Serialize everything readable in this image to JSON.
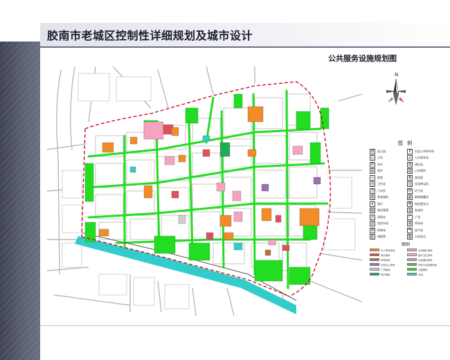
{
  "title": "胶南市老城区控制性详细规划及城市设计",
  "subtitle": "公共服务设施规划图",
  "north_label": "N",
  "legend": {
    "title": "图 例",
    "items": [
      {
        "icon": "kindergarten-icon",
        "label": "幼儿园"
      },
      {
        "icon": "parking-icon",
        "label": "社会公共停车场"
      },
      {
        "icon": "primary-school-icon",
        "label": "小学"
      },
      {
        "icon": "bus-station-icon",
        "label": "公交首末站"
      },
      {
        "icon": "middle-school-icon",
        "label": "初中"
      },
      {
        "icon": "substation-icon",
        "label": "调压站"
      },
      {
        "icon": "high-school-icon",
        "label": "高中"
      },
      {
        "icon": "toilet-icon",
        "label": "公共厕所"
      },
      {
        "icon": "hospital-icon",
        "label": "医院"
      },
      {
        "icon": "transformer-icon",
        "label": "变电室"
      },
      {
        "icon": "clinic-icon",
        "label": "卫生站"
      },
      {
        "icon": "waste-station-icon",
        "label": "垃圾转运站"
      },
      {
        "icon": "clinic-icon",
        "label": "门诊所"
      },
      {
        "icon": "sanitation-icon",
        "label": "环卫站"
      },
      {
        "icon": "elderly-care-icon",
        "label": "养老福利"
      },
      {
        "icon": "post-office-icon",
        "label": "邮政储蓄所"
      },
      {
        "icon": "bank-icon",
        "label": "银行"
      },
      {
        "icon": "telecom-icon",
        "label": "电信营业点"
      },
      {
        "icon": "property-icon",
        "label": "物业管理"
      },
      {
        "icon": "gas-station-icon",
        "label": "加油站"
      },
      {
        "icon": "fire-station-icon",
        "label": "消防站"
      },
      {
        "icon": "square-icon",
        "label": "广场"
      },
      {
        "icon": "market-icon",
        "label": "农贸市场"
      },
      {
        "icon": "parking-lot-icon",
        "label": "停车场"
      },
      {
        "icon": "stadium-icon",
        "label": "体育场"
      },
      {
        "icon": "gas-icon",
        "label": "加气站"
      },
      {
        "icon": "cinema-icon",
        "label": "电影院"
      },
      {
        "icon": "police-icon",
        "label": "公安站点"
      }
    ]
  },
  "legend2": {
    "title": "图例",
    "items": [
      {
        "label": "中小学校用地",
        "color": "#f28c28"
      },
      {
        "label": "文化娱乐用地",
        "color": "#f6a3c2"
      },
      {
        "label": "商业用地",
        "color": "#e0505a"
      },
      {
        "label": "医疗卫生用地",
        "color": "#f4b6d2"
      },
      {
        "label": "体育用地",
        "color": "#b87333"
      },
      {
        "label": "社会福利用地",
        "color": "#d39bc2"
      },
      {
        "label": "行政办公用地",
        "color": "#9e6fb5"
      },
      {
        "label": "市政公用设施用地",
        "color": "#6ab04c"
      },
      {
        "label": "广场用地",
        "color": "#cfcfcf"
      },
      {
        "label": "公园绿地",
        "color": "#22dd22"
      },
      {
        "label": "防护绿地",
        "color": "#11aa55"
      },
      {
        "label": "水域",
        "color": "#33cccc"
      }
    ]
  },
  "colors": {
    "green": "#22dd22",
    "water": "#33cccc",
    "boundary": "#cc1122",
    "road": "#aaaaaa"
  }
}
